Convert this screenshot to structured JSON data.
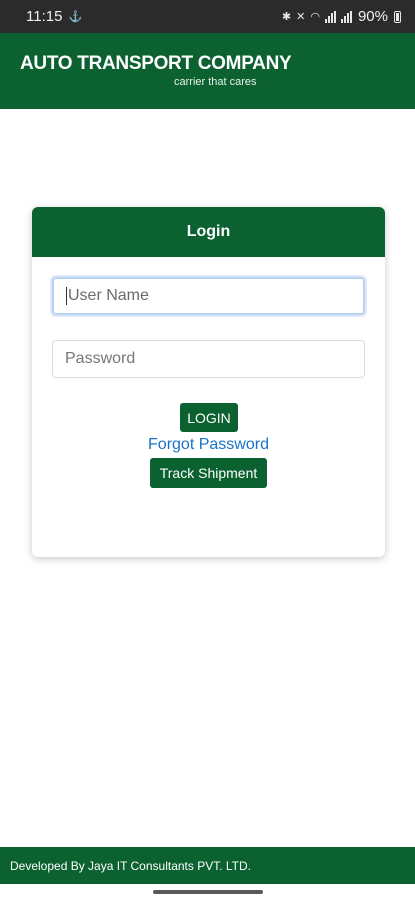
{
  "status_bar": {
    "time": "11:15",
    "battery": "90%"
  },
  "header": {
    "company_name": "AUTO TRANSPORT COMPANY",
    "tagline": "carrier that cares"
  },
  "login_card": {
    "title": "Login",
    "username_placeholder": "User Name",
    "password_placeholder": "Password",
    "login_label": "LOGIN",
    "forgot_label": "Forgot Password",
    "track_label": "Track Shipment"
  },
  "footer": {
    "text": "Developed By Jaya IT Consultants PVT. LTD."
  },
  "colors": {
    "brand_green": "#0b6130",
    "link_blue": "#1a73c9"
  }
}
